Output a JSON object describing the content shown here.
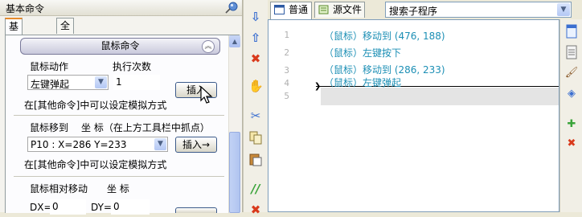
{
  "left_panel": {
    "title": "基本命令",
    "tabs": [
      "基本命令",
      "全部命令"
    ],
    "section_header": "鼠标命令",
    "mouse_action": {
      "label": "鼠标动作",
      "count_label": "执行次数",
      "select_value": "左键弹起",
      "count_value": "1",
      "insert_label": "插入",
      "hint": "在[其他命令]中可以设定模拟方式"
    },
    "mouse_move": {
      "label": "鼠标移到",
      "coord_label": "坐 标（在上方工具栏中抓点）",
      "select_value": "P10 : X=286 Y=233",
      "insert_label": "插入→",
      "hint": "在[其他命令]中可以设定模拟方式"
    },
    "mouse_relative": {
      "label": "鼠标相对移动",
      "coord_label": "坐 标",
      "dx_label": "DX=",
      "dx_value": "0",
      "dy_label": "DY=",
      "dy_value": "0"
    }
  },
  "editor": {
    "tabs": [
      "普通",
      "源文件"
    ],
    "subroutine_search": "搜索子程序",
    "line_numbers": [
      "1",
      "2",
      "3",
      "4",
      "5"
    ],
    "lines": [
      "（鼠标）移动到 (476, 188)",
      "（鼠标）左键按下",
      "（鼠标）移动到 (286, 233)",
      "（鼠标）左键弹起",
      ""
    ]
  },
  "colors": {
    "code_text": "#1c8fb5",
    "active_tab_accent": "#e68b2c"
  },
  "icons": {
    "middle_toolbar": [
      "arrow-down-icon",
      "arrow-up-icon",
      "delete-icon",
      "hand-icon",
      "cut-icon",
      "copy-icon",
      "paste-icon",
      "comment-icon",
      "uncomment-icon"
    ],
    "right_toolbar": [
      "document-icon",
      "notepad-icon",
      "brush-icon",
      "layers-icon",
      "add-tool-icon",
      "remove-tool-icon"
    ]
  }
}
